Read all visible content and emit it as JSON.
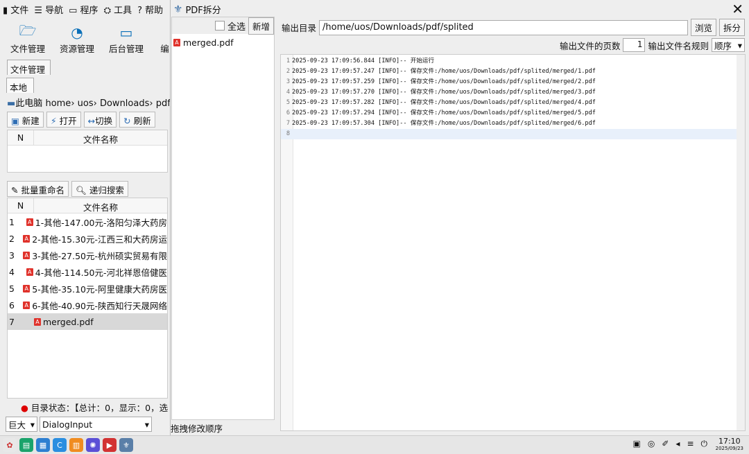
{
  "menubar": {
    "file": "文件",
    "nav": "导航",
    "program": "程序",
    "tools": "工具",
    "help": "帮助"
  },
  "bigbuttons": [
    "文件管理",
    "资源管理",
    "后台管理",
    "编"
  ],
  "tabs": {
    "filemgr": "文件管理",
    "local": "本地"
  },
  "breadcrumb": [
    "此电脑",
    "home",
    "uos",
    "Downloads",
    "pdf"
  ],
  "toolbar": {
    "new": "新建",
    "open": "打开",
    "switch": "切换",
    "refresh": "刷新"
  },
  "table1": {
    "col_n": "N",
    "col_name": "文件名称"
  },
  "actions": {
    "rename": "批量重命名",
    "search": "递归搜索"
  },
  "table2": {
    "col_n": "N",
    "col_name": "文件名称",
    "rows": [
      {
        "n": "1",
        "name": "1-其他-147.00元-洛阳匀泽大药房"
      },
      {
        "n": "2",
        "name": "2-其他-15.30元-江西三和大药房运"
      },
      {
        "n": "3",
        "name": "3-其他-27.50元-杭州硕实贸易有限"
      },
      {
        "n": "4",
        "name": "4-其他-114.50元-河北祥恩倍健医"
      },
      {
        "n": "5",
        "name": "5-其他-35.10元-阿里健康大药房医"
      },
      {
        "n": "6",
        "name": "6-其他-40.90元-陕西知行天晟网络"
      },
      {
        "n": "7",
        "name": "merged.pdf"
      }
    ]
  },
  "status": "目录状态：【总计：0，显示：0，选",
  "font": {
    "size": "巨大",
    "family": "DialogInput"
  },
  "dialog": {
    "title": "PDF拆分",
    "select_all": "全选",
    "add": "新增",
    "file": "merged.pdf",
    "drag_hint": "拖拽修改顺序",
    "outdir_label": "输出目录",
    "outdir_value": "/home/uos/Downloads/pdf/splited",
    "browse": "浏览",
    "split": "拆分",
    "pages_label": "输出文件的页数",
    "pages_value": "1",
    "rule_label": "输出文件名规则",
    "rule_value": "顺序"
  },
  "log": [
    "2025-09-23 17:09:56.844 [INFO]-- 开始运行",
    "2025-09-23 17:09:57.247 [INFO]-- 保存文件:/home/uos/Downloads/pdf/splited/merged/1.pdf",
    "2025-09-23 17:09:57.259 [INFO]-- 保存文件:/home/uos/Downloads/pdf/splited/merged/2.pdf",
    "2025-09-23 17:09:57.270 [INFO]-- 保存文件:/home/uos/Downloads/pdf/splited/merged/3.pdf",
    "2025-09-23 17:09:57.282 [INFO]-- 保存文件:/home/uos/Downloads/pdf/splited/merged/4.pdf",
    "2025-09-23 17:09:57.294 [INFO]-- 保存文件:/home/uos/Downloads/pdf/splited/merged/5.pdf",
    "2025-09-23 17:09:57.304 [INFO]-- 保存文件:/home/uos/Downloads/pdf/splited/merged/6.pdf",
    ""
  ],
  "clock": {
    "time": "17:10",
    "date": "2025/09/23"
  }
}
